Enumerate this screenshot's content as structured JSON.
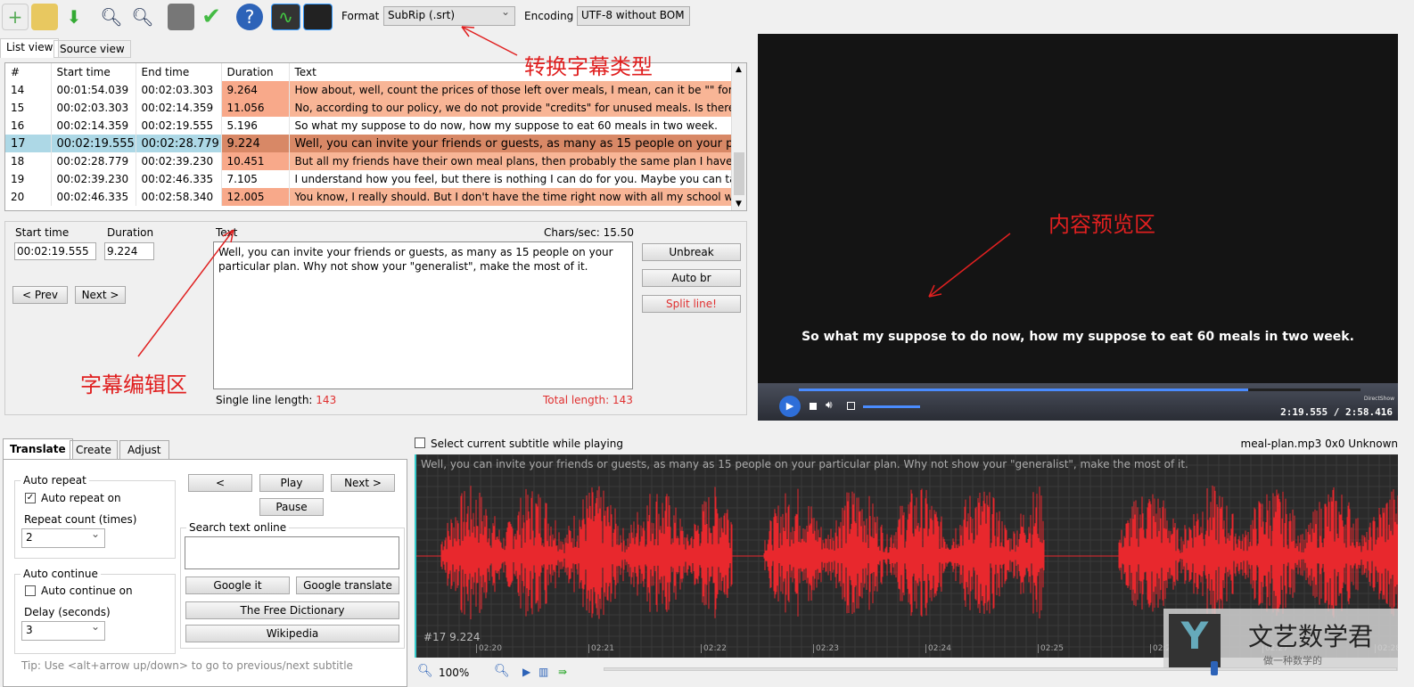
{
  "toolbar": {
    "icons": [
      "new-file-icon",
      "open-folder-icon",
      "download-icon",
      "find-icon",
      "replace-icon",
      "visual-sync-icon",
      "spell-check-icon",
      "help-icon",
      "waveform-toggle-icon",
      "video-toggle-icon"
    ],
    "format_label": "Format",
    "format_value": "SubRip (.srt)",
    "encoding_label": "Encoding",
    "encoding_value": "UTF-8 without BOM"
  },
  "annotations": {
    "format": "转换字幕类型",
    "preview": "内容预览区",
    "editor": "字幕编辑区"
  },
  "view_tabs": [
    "List view",
    "Source view"
  ],
  "table": {
    "headers": [
      "#",
      "Start time",
      "End time",
      "Duration",
      "Text"
    ],
    "rows": [
      [
        "14",
        "00:01:54.039",
        "00:02:03.303",
        "9.264",
        "How about, well, count the prices of those left over meals, I mean, can it be \"\" for..."
      ],
      [
        "15",
        "00:02:03.303",
        "00:02:14.359",
        "11.056",
        "No, according to our policy, we do not provide \"credits\" for unused meals. Is there..."
      ],
      [
        "16",
        "00:02:14.359",
        "00:02:19.555",
        "5.196",
        "So what my suppose to do now, how my suppose to eat 60 meals in two week."
      ],
      [
        "17",
        "00:02:19.555",
        "00:02:28.779",
        "9.224",
        "Well, you can invite your friends or guests, as many as 15 people on your partic..."
      ],
      [
        "18",
        "00:02:28.779",
        "00:02:39.230",
        "10.451",
        "But all my friends have their own meal plans, then probably the same plan I have ..."
      ],
      [
        "19",
        "00:02:39.230",
        "00:02:46.335",
        "7.105",
        "I understand how you feel, but there is nothing I can do for you. Maybe you can ta..."
      ],
      [
        "20",
        "00:02:46.335",
        "00:02:58.340",
        "12.005",
        "You know, I really should. But I don't have the time right now with all my school w..."
      ]
    ]
  },
  "editor": {
    "start_label": "Start time",
    "start_value": "00:02:19.555",
    "duration_label": "Duration",
    "duration_value": "9.224",
    "prev": "< Prev",
    "next": "Next >",
    "text_label": "Text",
    "chars_sec": "Chars/sec: 15.50",
    "text": "Well, you can invite your friends or guests, as many as 15 people on your particular plan. Why not show your \"generalist\", make the most of it.",
    "unbreak": "Unbreak",
    "auto_br": "Auto br",
    "split": "Split line!",
    "single_label": "Single line length:",
    "single_value": "143",
    "total_label": "Total length:",
    "total_value": "143"
  },
  "video": {
    "subtitle": "So what my suppose to do now, how my suppose to eat 60 meals in two week.",
    "time": "2:19.555 / 2:58.416",
    "renderer": "DirectShow",
    "progress": 0.8
  },
  "bottom_tabs": [
    "Translate",
    "Create",
    "Adjust"
  ],
  "translate": {
    "auto_repeat": "Auto repeat",
    "auto_repeat_on": "Auto repeat on",
    "repeat_count_label": "Repeat count (times)",
    "repeat_count": "2",
    "auto_continue": "Auto continue",
    "auto_continue_on": "Auto continue on",
    "delay_label": "Delay (seconds)",
    "delay": "3",
    "prev": "<",
    "play": "Play",
    "next": "Next >",
    "pause": "Pause",
    "search_label": "Search text online",
    "google": "Google it",
    "google_translate": "Google translate",
    "free_dict": "The Free Dictionary",
    "wikipedia": "Wikipedia",
    "tip": "Tip: Use <alt+arrow up/down> to go to previous/next subtitle"
  },
  "waveform": {
    "select_label": "Select current subtitle while playing",
    "file_info": "meal-plan.mp3 0x0 Unknown",
    "subtitle": "Well, you can invite your friends or guests, as many as 15 people on your particular plan. Why not show your \"generalist\", make the most of it.",
    "marker": "#17  9.224",
    "ticks": [
      "02:20",
      "02:21",
      "02:22",
      "02:23",
      "02:24",
      "02:25",
      "02:26",
      "02:27",
      "02:28"
    ],
    "zoom": "100%",
    "wave_color": "#e8282d"
  },
  "watermark": {
    "title": "文艺数学君",
    "subtitle": "做一种数学的"
  }
}
